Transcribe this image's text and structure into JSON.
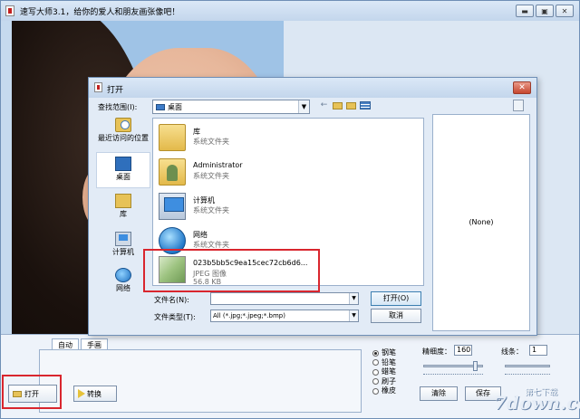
{
  "app": {
    "title": "速写大师3.1，给你的爱人和朋友画张像吧！",
    "window_controls": [
      "minimize",
      "maximize",
      "close"
    ]
  },
  "dialog": {
    "title": "打开",
    "look_in_label": "查找范围(I):",
    "look_in_value": "桌面",
    "places": [
      {
        "label": "最近访问的位置",
        "icon": "recent-places-icon"
      },
      {
        "label": "桌面",
        "icon": "desktop-icon",
        "selected": true
      },
      {
        "label": "库",
        "icon": "libraries-icon"
      },
      {
        "label": "计算机",
        "icon": "computer-icon"
      },
      {
        "label": "网络",
        "icon": "network-icon"
      }
    ],
    "files": [
      {
        "name": "库",
        "type": "系统文件夹",
        "size": "",
        "icon": "library-folder-icon"
      },
      {
        "name": "Administrator",
        "type": "系统文件夹",
        "size": "",
        "icon": "user-folder-icon"
      },
      {
        "name": "计算机",
        "type": "系统文件夹",
        "size": "",
        "icon": "computer-icon"
      },
      {
        "name": "网络",
        "type": "系统文件夹",
        "size": "",
        "icon": "network-icon"
      },
      {
        "name": "023b5bb5c9ea15cec72cb6d6...",
        "type": "JPEG 图像",
        "size": "56.8 KB",
        "icon": "image-file-icon"
      }
    ],
    "filename_label": "文件名(N):",
    "filename_value": "",
    "filetype_label": "文件类型(T):",
    "filetype_value": "All (*.jpg;*.jpeg;*.bmp)",
    "open_button": "打开(O)",
    "cancel_button": "取消",
    "preview_text": "(None)"
  },
  "bottom": {
    "tabs": [
      "自动",
      "手画"
    ],
    "open_button": "打开",
    "convert_button": "转换",
    "brushes": [
      {
        "label": "钢笔",
        "selected": true
      },
      {
        "label": "铅笔",
        "selected": false
      },
      {
        "label": "蜡笔",
        "selected": false
      },
      {
        "label": "刷子",
        "selected": false
      },
      {
        "label": "橡皮",
        "selected": false
      }
    ],
    "fineness_label": "精细度：",
    "fineness_value": "160",
    "lines_label": "线条：",
    "lines_value": "1",
    "clear_button": "清除",
    "save_button": "保存"
  },
  "watermark": {
    "main": "7down.com",
    "sub": "第七下载"
  },
  "colors": {
    "highlight_red": "#d9262e",
    "window_bg": "#c5d9ee",
    "canvas_bg": "#9fc3e6"
  }
}
